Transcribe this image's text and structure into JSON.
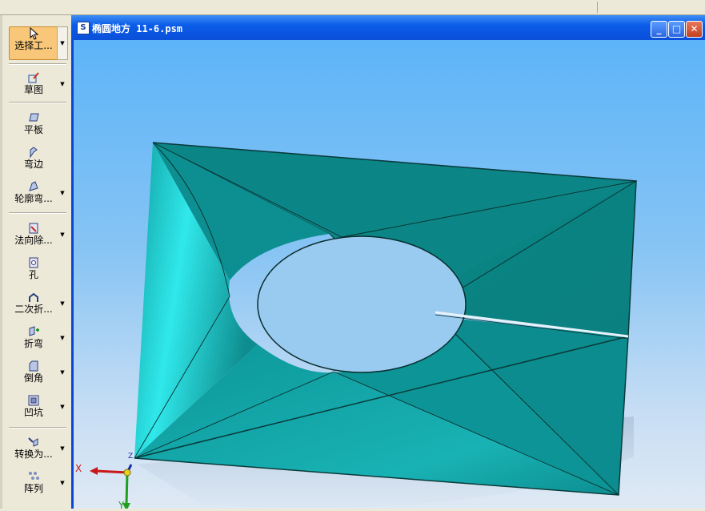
{
  "window": {
    "title": "椭圆地方 11-6.psm",
    "app_icon": "solid-edge-icon",
    "buttons": {
      "minimize": "_",
      "maximize": "□",
      "close": "✕"
    }
  },
  "toolbar": {
    "items": [
      {
        "label": "选择工...",
        "icon": "select-arrow-icon",
        "dropdown": true,
        "active": true
      },
      {
        "label": "草图",
        "icon": "sketch-icon",
        "dropdown": true
      },
      {
        "label": "平板",
        "icon": "tab-icon",
        "dropdown": false
      },
      {
        "label": "弯边",
        "icon": "flange-icon",
        "dropdown": false
      },
      {
        "label": "轮廓弯...",
        "icon": "contour-flange-icon",
        "dropdown": true
      },
      {
        "label": "法向除...",
        "icon": "normal-cutout-icon",
        "dropdown": true
      },
      {
        "label": "孔",
        "icon": "hole-icon",
        "dropdown": false
      },
      {
        "label": "二次折...",
        "icon": "second-bend-icon",
        "dropdown": true
      },
      {
        "label": "折弯",
        "icon": "bend-icon",
        "dropdown": true
      },
      {
        "label": "倒角",
        "icon": "chamfer-icon",
        "dropdown": true
      },
      {
        "label": "凹坑",
        "icon": "dimple-icon",
        "dropdown": true
      },
      {
        "label": "转换为...",
        "icon": "convert-icon",
        "dropdown": true
      },
      {
        "label": "阵列",
        "icon": "pattern-icon",
        "dropdown": true
      }
    ]
  },
  "axes": {
    "x_label": "X",
    "y_label": "Y",
    "z_label": "Z"
  },
  "colors": {
    "part": "#0f9a9c",
    "edge": "#0a3a3a",
    "background_top": "#5db4f8",
    "background_bottom": "#dfe9f4"
  }
}
